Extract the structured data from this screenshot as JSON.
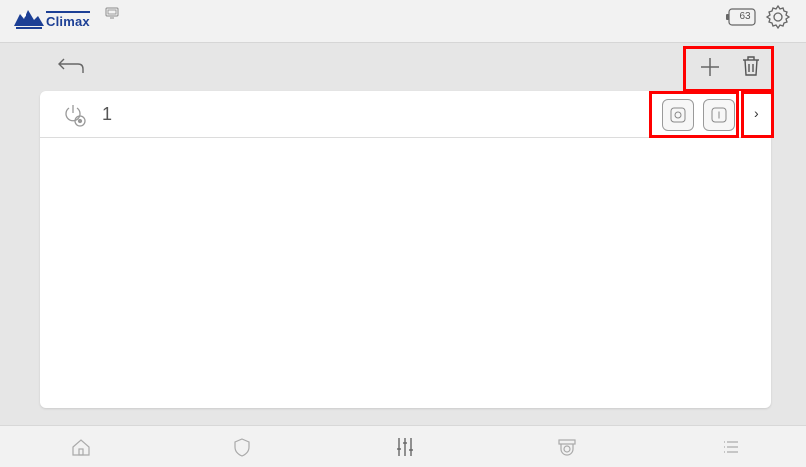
{
  "header": {
    "brand": "Climax",
    "battery_level": "63"
  },
  "device_list": {
    "items": [
      {
        "label": "1"
      }
    ]
  },
  "colors": {
    "brand_blue": "#1c3f95",
    "highlight_red": "#ff0000",
    "background": "#e6e6e6"
  },
  "icons": {
    "header": [
      "climax-logo-icon",
      "monitor-icon",
      "battery-icon",
      "gear-icon"
    ],
    "toolbar": [
      "back-arrow-icon",
      "plus-icon",
      "trash-icon"
    ],
    "row": [
      "smart-plug-icon",
      "power-off-icon",
      "power-on-icon",
      "chevron-right-icon"
    ],
    "bottom_nav": [
      "home-icon",
      "shield-icon",
      "sliders-icon",
      "camera-icon",
      "list-icon"
    ]
  }
}
